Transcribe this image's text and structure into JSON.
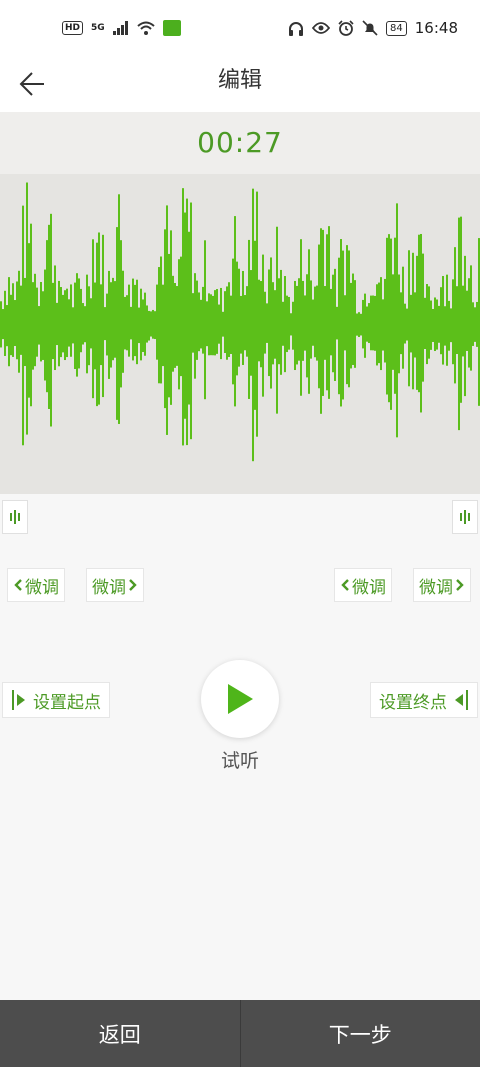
{
  "status_bar": {
    "left_indicators": [
      "HD",
      "5G"
    ],
    "time": "16:48",
    "battery": "84"
  },
  "app_bar": {
    "title": "编辑"
  },
  "playback": {
    "elapsed": "00:27"
  },
  "colors": {
    "accent": "#4c9a25",
    "wave": "#5cbf1a",
    "wave_bg": "#e5e4e1",
    "bottom_bar": "#4d4d4d"
  },
  "controls": {
    "start_tweak_back": "微调",
    "start_tweak_forward": "微调",
    "end_tweak_back": "微调",
    "end_tweak_forward": "微调",
    "set_start": "设置起点",
    "set_end": "设置终点",
    "preview": "试听"
  },
  "bottom_bar": {
    "back": "返回",
    "next": "下一步"
  }
}
